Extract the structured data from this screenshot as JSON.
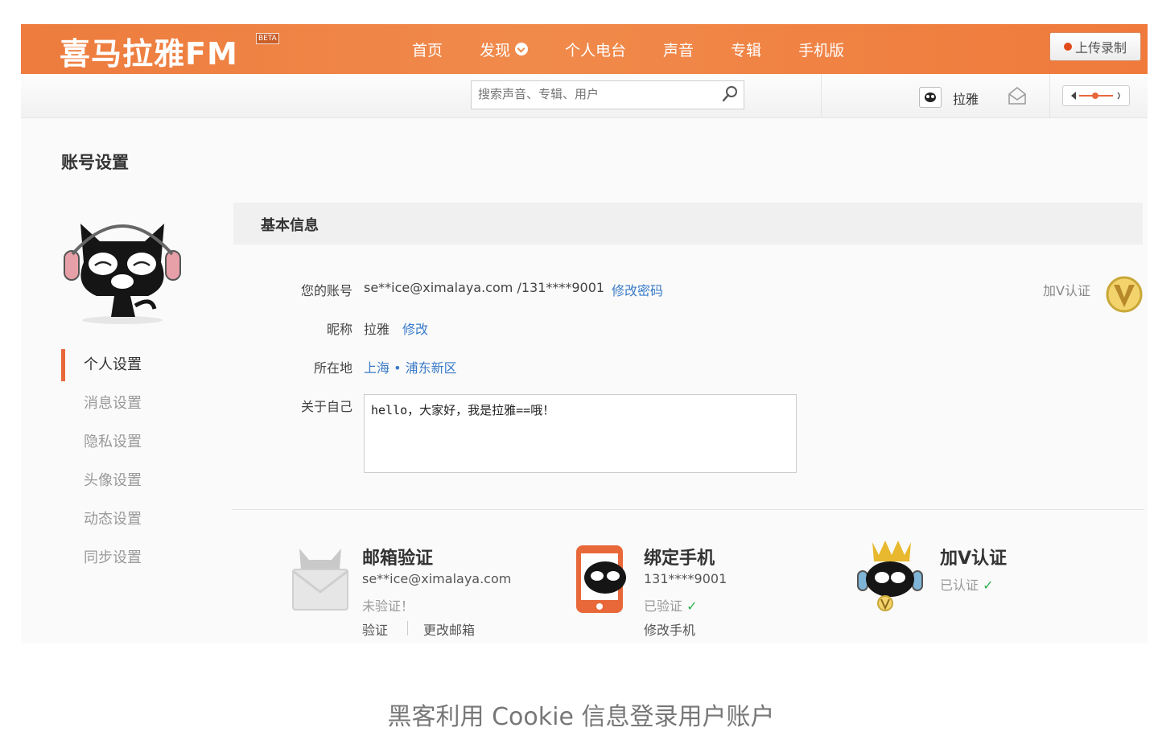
{
  "header": {
    "logo": "喜马拉雅FM",
    "beta": "BETA",
    "nav": [
      "首页",
      "发现",
      "个人电台",
      "声音",
      "专辑",
      "手机版"
    ],
    "upload_label": "上传录制"
  },
  "subbar": {
    "search_placeholder": "搜索声音、专辑、用户",
    "username": "拉雅"
  },
  "page": {
    "title": "账号设置",
    "sidenav": [
      "个人设置",
      "消息设置",
      "隐私设置",
      "头像设置",
      "动态设置",
      "同步设置"
    ],
    "active_item": "个人设置",
    "section_title": "基本信息"
  },
  "basic_info": {
    "account_label": "您的账号",
    "account_value": "se**ice@ximalaya.com /131****9001",
    "change_password": "修改密码",
    "nickname_label": "昵称",
    "nickname_value": "拉雅",
    "nickname_edit": "修改",
    "location_label": "所在地",
    "location_value": "上海 • 浦东新区",
    "about_label": "关于自己",
    "about_value": "hello，大家好，我是拉雅==哦！",
    "v_cert_label": "加V认证"
  },
  "cards": {
    "email": {
      "title": "邮箱验证",
      "address": "se**ice@ximalaya.com",
      "status": "未验证！",
      "verify": "验证",
      "change": "更改邮箱"
    },
    "phone": {
      "title": "绑定手机",
      "number": "131****9001",
      "status": "已验证",
      "change": "修改手机"
    },
    "v": {
      "title": "加V认证",
      "status": "已认证"
    }
  },
  "caption": "黑客利用 Cookie 信息登录用户账户",
  "colors": {
    "accent": "#f08a4b",
    "link": "#3a7bc8",
    "success": "#2bb04a"
  }
}
